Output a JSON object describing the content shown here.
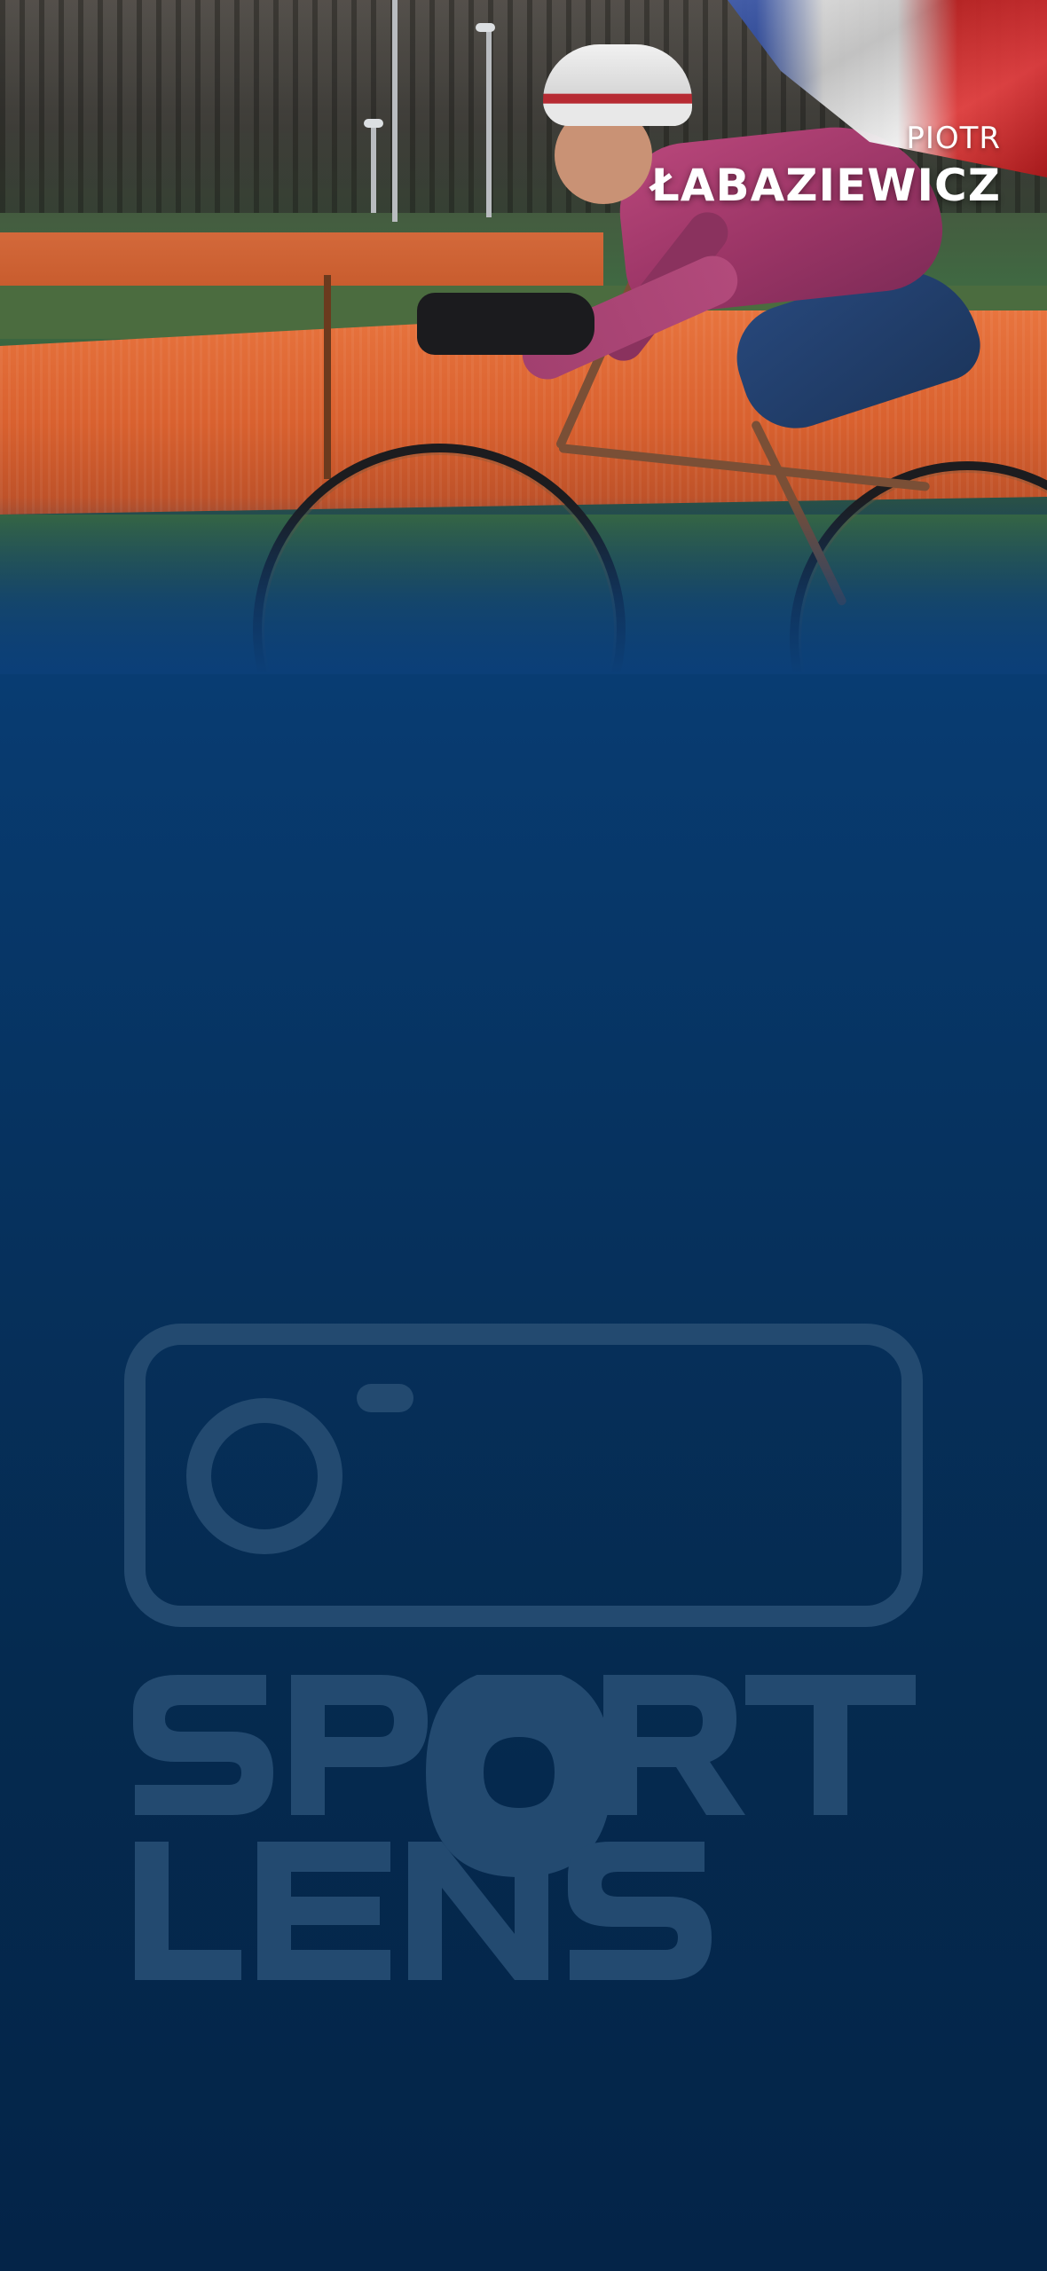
{
  "athlete": {
    "first_name": "PIOTR",
    "last_name": "ŁABAZIEWICZ"
  },
  "hero": {
    "flag": "france-flag",
    "subject": "cyclocross-rider"
  },
  "brand": {
    "logo_icon": "camera-icon",
    "wordmark": "SPORT LENS"
  },
  "colors": {
    "background_top": "#0b3f78",
    "background_bottom": "#042448",
    "name_text": "#ffffff",
    "watermark": "#234a70"
  }
}
